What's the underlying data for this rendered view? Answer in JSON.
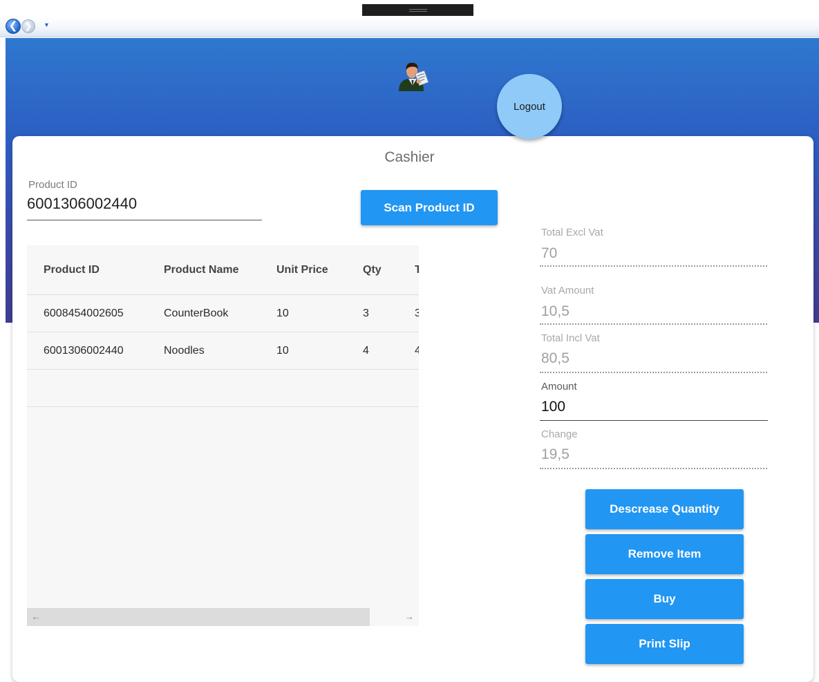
{
  "header": {
    "logout_label": "Logout"
  },
  "page": {
    "title": "Cashier"
  },
  "product_input": {
    "label": "Product ID",
    "value": "6001306002440"
  },
  "buttons": {
    "scan": "Scan Product ID",
    "decrease": "Descrease Quantity",
    "remove": "Remove Item",
    "buy": "Buy",
    "print": "Print Slip"
  },
  "grid": {
    "columns": [
      "Product ID",
      "Product Name",
      "Unit Price",
      "Qty",
      "T"
    ],
    "rows": [
      [
        "6008454002605",
        "CounterBook",
        "10",
        "3",
        "3"
      ],
      [
        "6001306002440",
        "Noodles",
        "10",
        "4",
        "4"
      ]
    ]
  },
  "totals": {
    "excl_label": "Total Excl Vat",
    "excl_value": "70",
    "vat_label": "Vat Amount",
    "vat_value": "10,5",
    "incl_label": "Total Incl Vat",
    "incl_value": "80,5",
    "amount_label": "Amount",
    "amount_value": "100",
    "change_label": "Change",
    "change_value": "19,5"
  },
  "colors": {
    "accent": "#2196f3",
    "logout": "#90caf9",
    "header_top": "#2f78cf",
    "header_bottom": "#3f3d8f"
  },
  "icons": {
    "back": "back-arrow-icon",
    "forward": "forward-arrow-icon",
    "user": "cashier-user-icon"
  }
}
